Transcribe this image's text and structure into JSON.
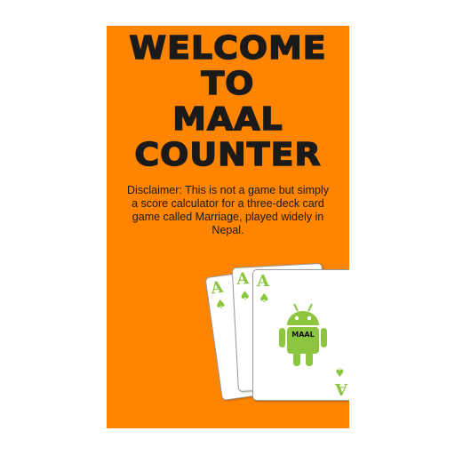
{
  "title": {
    "lines": [
      "WELCOME",
      "TO",
      "MAAL",
      "COUNTER"
    ]
  },
  "disclaimer": "Disclaimer: This is not a game but simply a score calculator for a three-deck card game called Marriage, played widely in Nepal.",
  "cards": {
    "rank": "A",
    "suit_icon": "spade-icon",
    "mascot_label": "MAAL",
    "mascot_icon": "android-robot-icon"
  },
  "colors": {
    "background": "#ff8400",
    "title_text": "#1a1a1a",
    "card_accent": "#8cc63f"
  }
}
